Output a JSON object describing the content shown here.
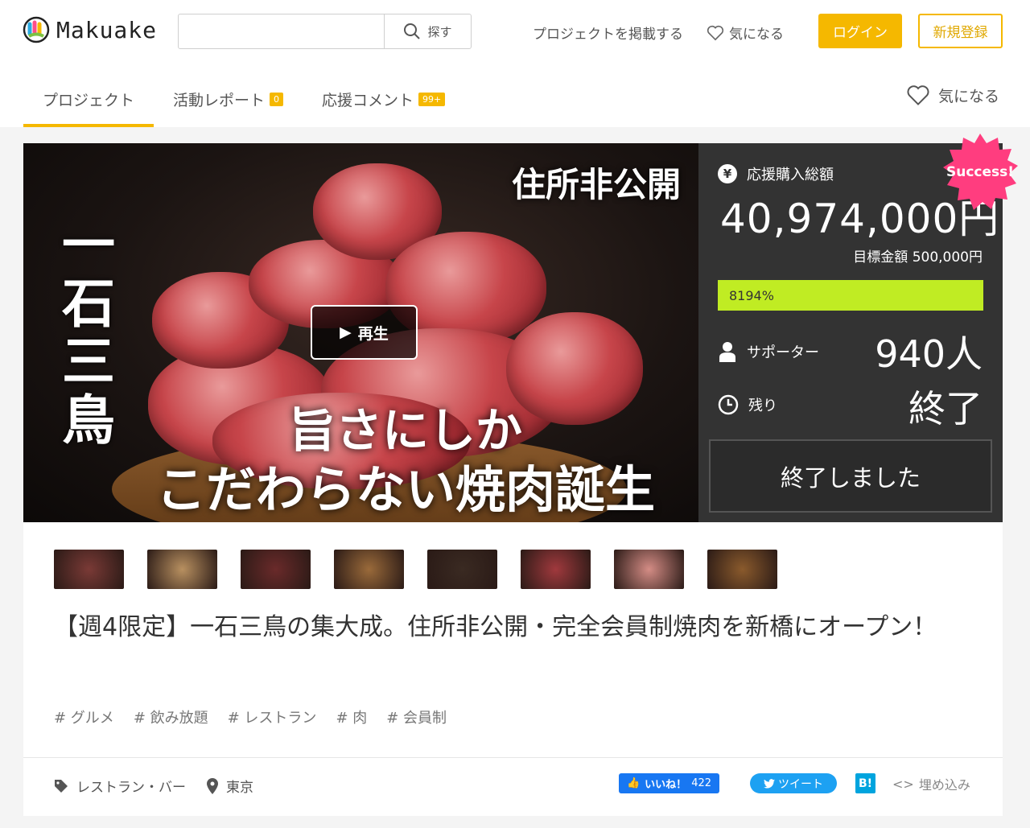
{
  "header": {
    "logo_text": "Makuake",
    "search": {
      "placeholder": "",
      "button_label": "探す"
    },
    "nav": {
      "post_project": "プロジェクトを掲載する",
      "favorite": "気になる"
    },
    "login": "ログイン",
    "register": "新規登録"
  },
  "tabs": [
    {
      "label": "プロジェクト",
      "badge": ""
    },
    {
      "label": "活動レポート",
      "badge": "0"
    },
    {
      "label": "応援コメント",
      "badge": "99+"
    }
  ],
  "favorite_right": "気になる",
  "hero": {
    "top_text": "住所非公開",
    "vertical_text": "一石三鳥",
    "line1": "旨さにしか",
    "line2": "こだわらない焼肉誕生",
    "play_label": "再生"
  },
  "stats": {
    "total_label": "応援購入総額",
    "total_value": "40,974,000円",
    "goal_text": "目標金額 500,000円",
    "progress_percent": 8194,
    "progress_text": "8194%",
    "supporters_label": "サポーター",
    "supporters_value": "940人",
    "remaining_label": "残り",
    "remaining_value": "終了",
    "ended_button": "終了しました",
    "success_badge": "Success!"
  },
  "thumbnails": [
    {
      "name": "thumb-main-visual",
      "color": "#7a3a36"
    },
    {
      "name": "thumb-garlic-rice",
      "color": "#b89060"
    },
    {
      "name": "thumb-steak-plate",
      "color": "#6a2a2a"
    },
    {
      "name": "thumb-salad-meat",
      "color": "#9a6a3a"
    },
    {
      "name": "thumb-chef",
      "color": "#3a2a22"
    },
    {
      "name": "thumb-sliced-beef",
      "color": "#a0393d"
    },
    {
      "name": "thumb-tongue",
      "color": "#d48c85"
    },
    {
      "name": "thumb-egg-bowl",
      "color": "#8a5a2c"
    }
  ],
  "project_title": "【週4限定】一石三鳥の集大成。住所非公開・完全会員制焼肉を新橋にオープン！",
  "tags": [
    "# グルメ",
    "# 飲み放題",
    "# レストラン",
    "# 肉",
    "# 会員制"
  ],
  "footer": {
    "category": "レストラン・バー",
    "location": "東京",
    "fb_like": "いいね！",
    "fb_count": "422",
    "tweet": "ツイート",
    "hatena": "B!",
    "embed": "埋め込み"
  },
  "colors": {
    "brand_yellow": "#f5b800",
    "progress_green": "#c0ec23",
    "stats_bg": "#333333",
    "success_pink": "#ff3d7f"
  }
}
